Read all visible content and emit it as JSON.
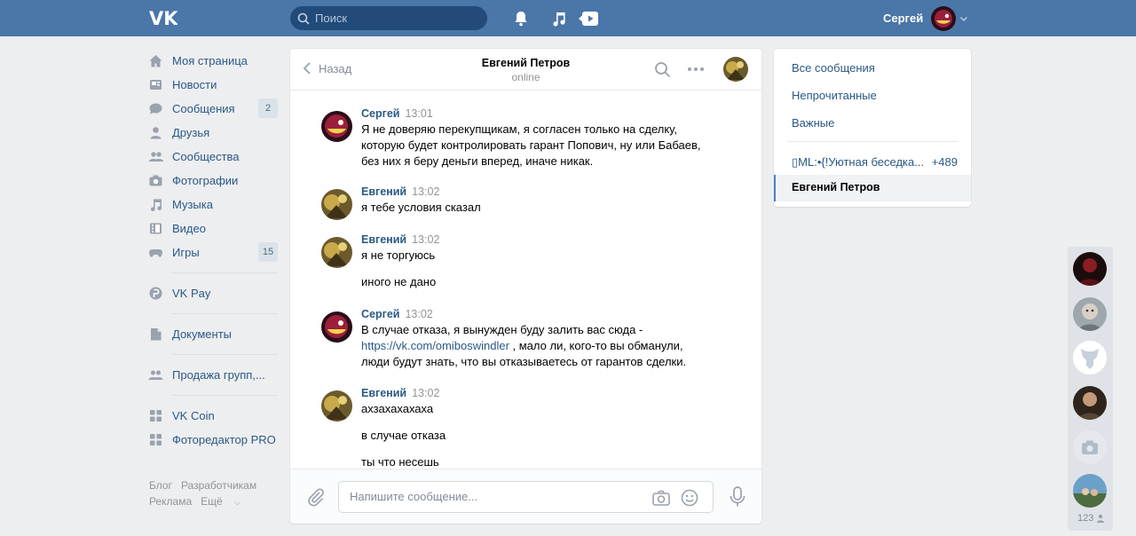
{
  "header": {
    "search_placeholder": "Поиск",
    "user_name": "Сергей"
  },
  "leftnav": {
    "items": [
      {
        "label": "Моя страница",
        "icon": "home-icon"
      },
      {
        "label": "Новости",
        "icon": "news-icon"
      },
      {
        "label": "Сообщения",
        "icon": "messages-icon",
        "badge": "2"
      },
      {
        "label": "Друзья",
        "icon": "friends-icon"
      },
      {
        "label": "Сообщества",
        "icon": "groups-icon"
      },
      {
        "label": "Фотографии",
        "icon": "camera-icon"
      },
      {
        "label": "Музыка",
        "icon": "music-icon"
      },
      {
        "label": "Видео",
        "icon": "video-icon"
      },
      {
        "label": "Игры",
        "icon": "games-icon",
        "badge": "15"
      },
      {
        "label": "VK Pay",
        "icon": "vkpay-icon"
      },
      {
        "label": "Документы",
        "icon": "docs-icon"
      },
      {
        "label": "Продажа групп,...",
        "icon": "group-icon"
      },
      {
        "label": "VK Coin",
        "icon": "app-icon"
      },
      {
        "label": "Фоторедактор PRO",
        "icon": "app-icon"
      }
    ],
    "footer": [
      "Блог",
      "Разработчикам",
      "Реклама",
      "Ещё"
    ]
  },
  "chat": {
    "back_label": "Назад",
    "peer_name": "Евгений Петров",
    "peer_status": "online",
    "messages": [
      {
        "author": "Сергей",
        "time": "13:01",
        "lines": [
          "Я не доверяю перекупщикам, я согласен только на сделку,",
          "которую будет контролировать гарант Попович, ну или Бабаев,",
          "без них я беру деньги вперед, иначе никак."
        ]
      },
      {
        "author": "Евгений",
        "time": "13:02",
        "lines": [
          "я тебе условия сказал"
        ]
      },
      {
        "author": "Евгений",
        "time": "13:02",
        "lines": [
          "я не торгуюсь",
          "иного не дано"
        ]
      },
      {
        "author": "Сергей",
        "time": "13:02",
        "lines": [
          "В случае отказа, я вынужден буду залить вас сюда -",
          "https://vk.com/omiboswindler",
          " , мало ли, кого-то вы обманули,",
          "люди будут знать, что вы отказываетесь от гарантов сделки."
        ]
      },
      {
        "author": "Евгений",
        "time": "13:02",
        "lines": [
          "ахзахахахаха",
          "в случае отказа",
          "ты что несешь"
        ]
      }
    ],
    "composer_placeholder": "Напишите сообщение..."
  },
  "rmenu": {
    "items": [
      "Все сообщения",
      "Непрочитанные",
      "Важные"
    ],
    "conversation": {
      "title": "▯ML:•{!Уютная беседка...",
      "count": "+489"
    },
    "active": "Евгений Петров"
  },
  "chatlist": {
    "count": "123"
  },
  "colors": {
    "header": "#4a76a8",
    "link": "#2a5885",
    "background": "#edeef0"
  }
}
